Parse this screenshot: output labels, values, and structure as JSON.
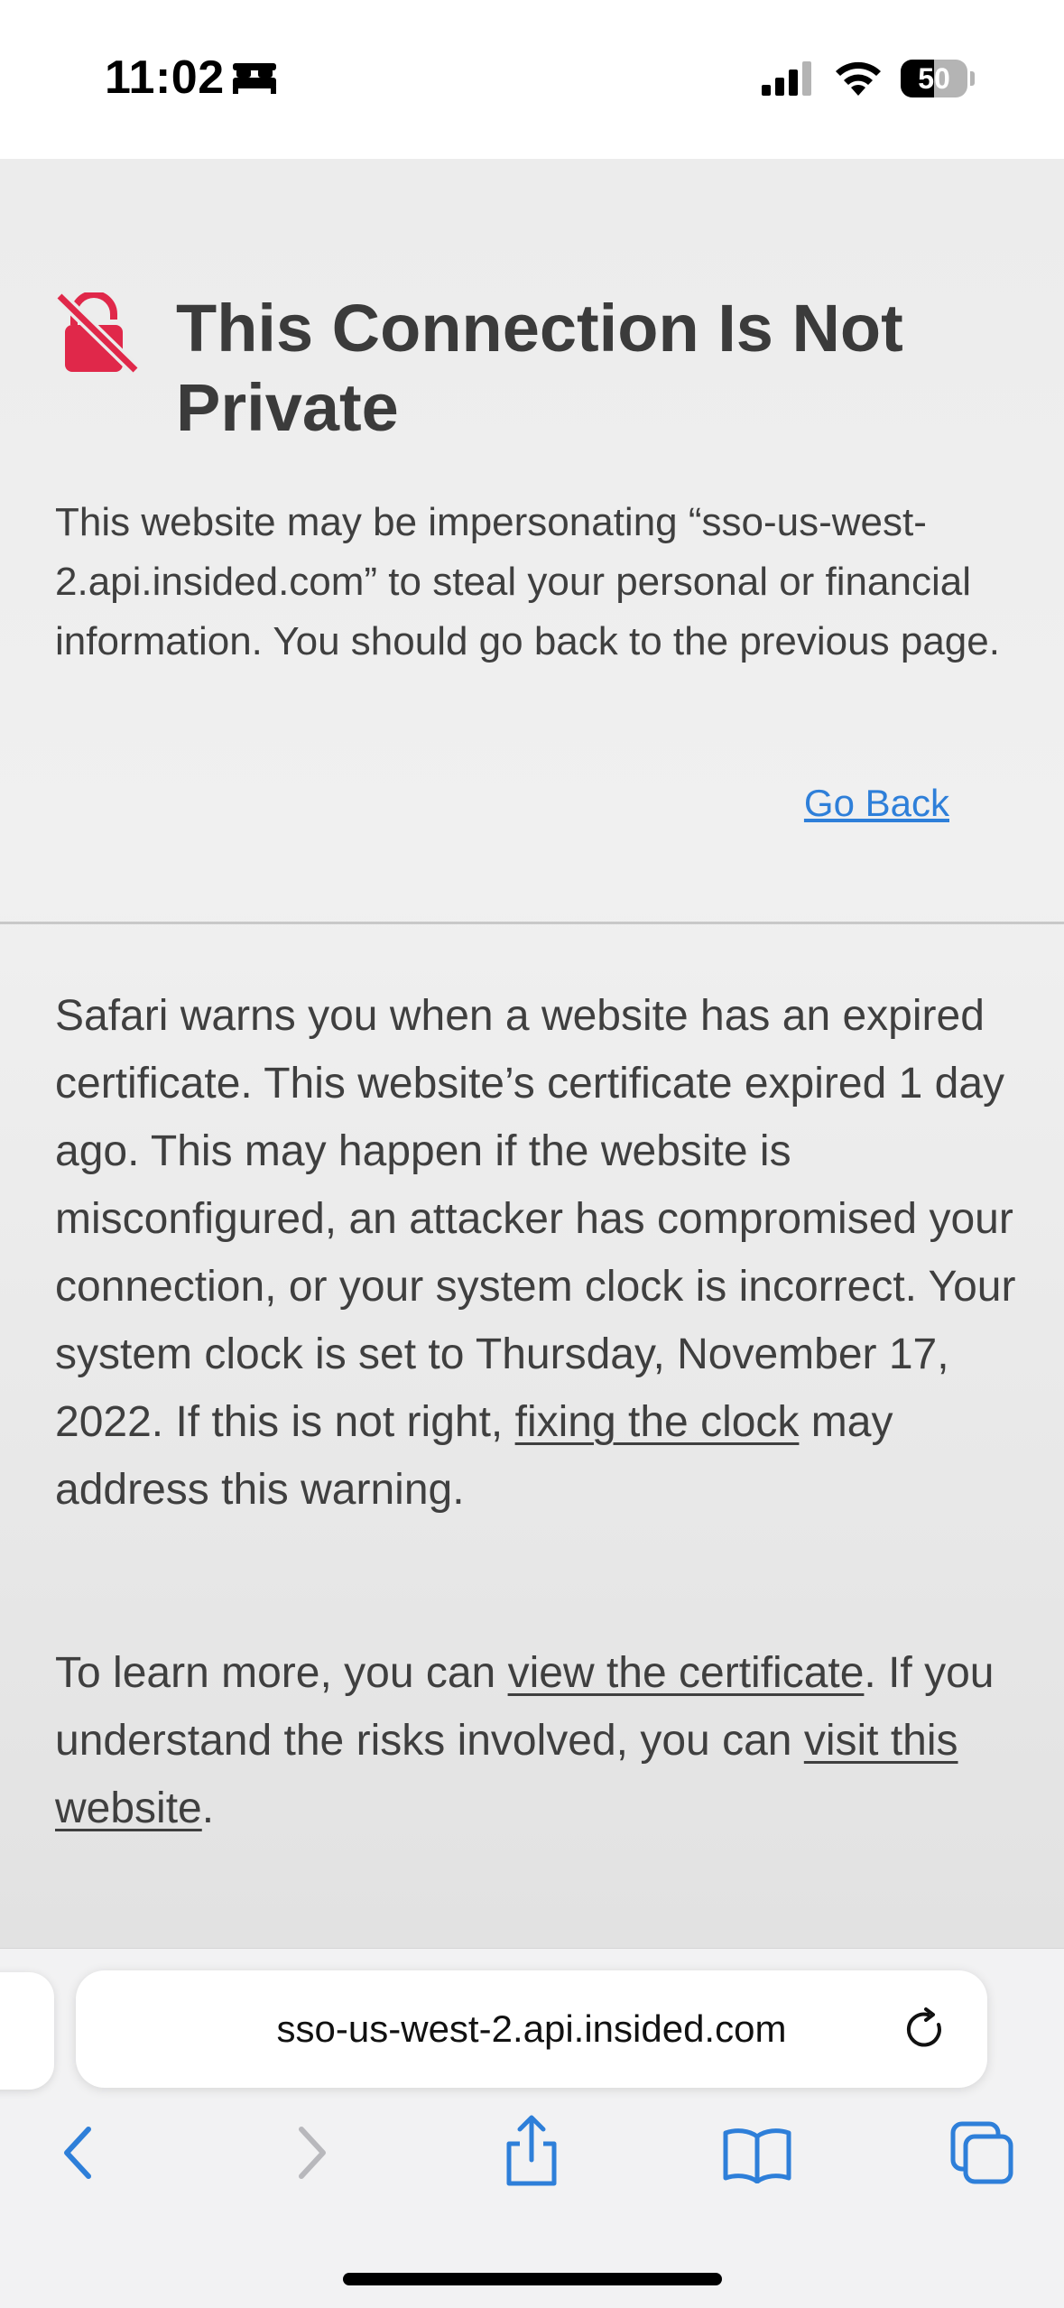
{
  "status_bar": {
    "time": "11:02",
    "battery_level": "50",
    "battery_fraction": 0.5
  },
  "warning": {
    "title": "This Connection Is Not Private",
    "intro": "This website may be impersonating “sso-us-west-2.api.insided.com” to steal your personal or financial information. You should go back to the previous page.",
    "go_back_label": "Go Back",
    "details_text_1": "Safari warns you when a website has an expired certificate. This website’s certificate expired 1 day ago. This may happen if the website is misconfigured, an attacker has compromised your connection, or your system clock is incorrect. Your system clock is set to Thursday, November 17, 2022. If this is not right, ",
    "fix_clock_link": "fixing the clock",
    "details_text_2": " may address this warning.",
    "learn_text_1": "To learn more, you can ",
    "view_certificate_link": "view the certificate",
    "learn_text_2": ". If you understand the risks involved, you can ",
    "visit_website_link": "visit this website",
    "learn_text_3": "."
  },
  "toolbar": {
    "address": "sso-us-west-2.api.insided.com"
  },
  "colors": {
    "accent": "#2e7fd9",
    "warning_red": "#e0284a",
    "text": "#3f3f3f"
  },
  "icons": [
    "bed-icon",
    "cellular-signal-icon",
    "wifi-icon",
    "battery-icon",
    "broken-lock-icon",
    "reload-icon",
    "back-arrow-icon",
    "forward-arrow-icon",
    "share-icon",
    "bookmarks-icon",
    "tabs-icon"
  ]
}
